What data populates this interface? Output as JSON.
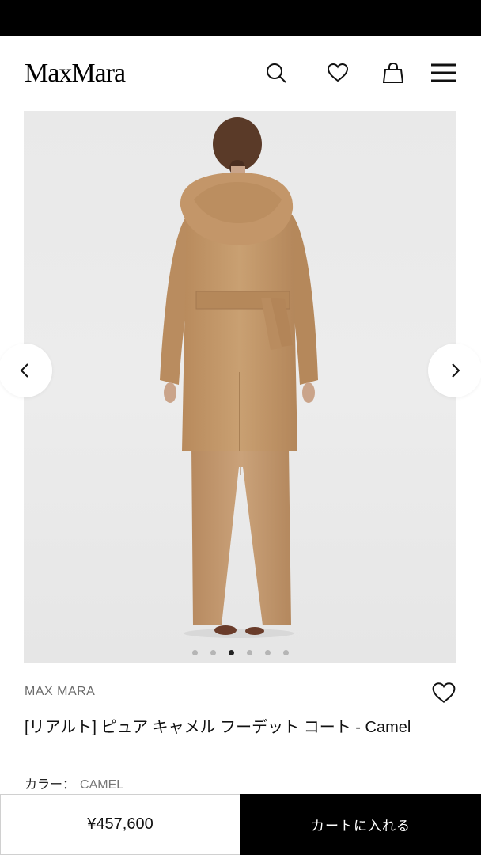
{
  "header": {
    "logo": "MaxMara",
    "icons": [
      "search-icon",
      "heart-icon",
      "shopping-bag-icon",
      "menu-icon"
    ]
  },
  "gallery": {
    "image_count": 6,
    "active_index": 2,
    "prev_icon": "chevron-left-icon",
    "next_icon": "chevron-right-icon"
  },
  "product": {
    "brand": "MAX MARA",
    "title": "[リアルト] ピュア キャメル フーデット コート - Camel",
    "color_label": "カラー：",
    "color_value": "CAMEL"
  },
  "bottom_bar": {
    "price": "¥457,600",
    "add_to_cart": "カートに入れる"
  },
  "colors": {
    "coat": "#c49a6c",
    "background": "#ebebeb",
    "button": "#000000"
  }
}
